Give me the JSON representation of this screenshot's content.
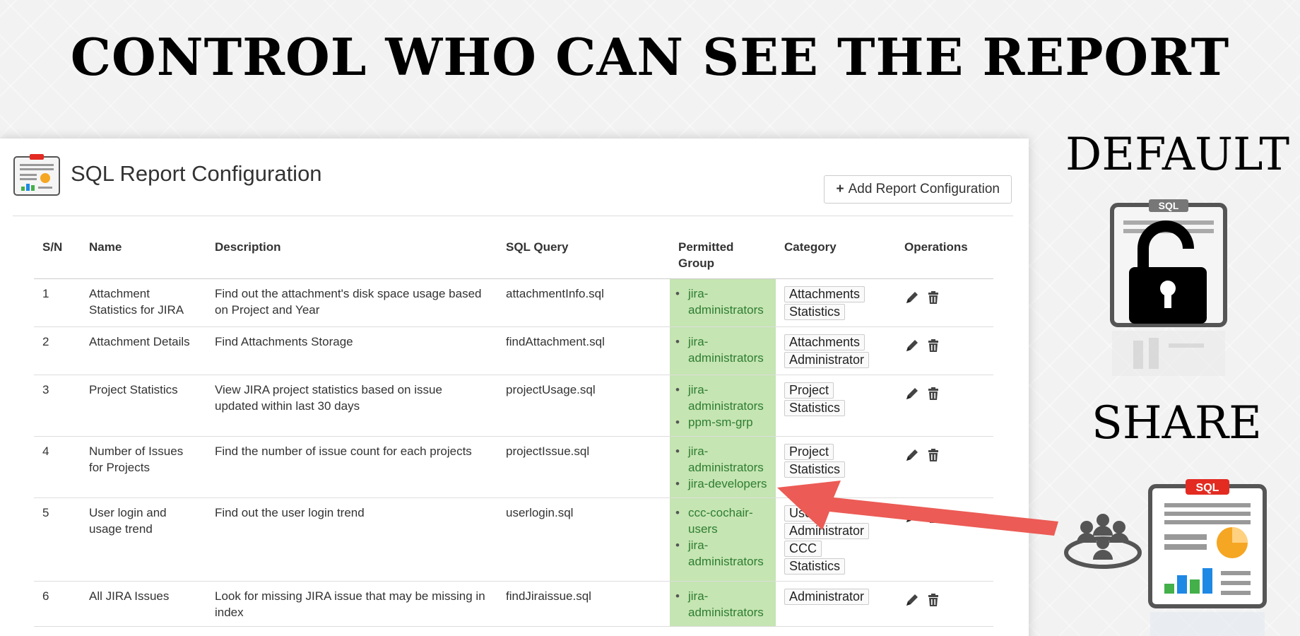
{
  "headline": "CONTROL WHO CAN SEE THE REPORT",
  "side": {
    "default_label": "DEFAULT",
    "share_label": "SHARE",
    "sql_badge": "SQL"
  },
  "panel": {
    "title": "SQL Report Configuration",
    "add_button": "Add Report Configuration",
    "columns": [
      "S/N",
      "Name",
      "Description",
      "SQL Query",
      "Permitted Group",
      "Category",
      "Operations"
    ],
    "rows": [
      {
        "sn": "1",
        "name": "Attachment Statistics for JIRA",
        "description": "Find out the attachment's disk space usage based on Project and Year",
        "query": "attachmentInfo.sql",
        "groups": [
          "jira-administrators"
        ],
        "categories": [
          "Attachments",
          "Statistics"
        ]
      },
      {
        "sn": "2",
        "name": "Attachment Details",
        "description": "Find Attachments Storage",
        "query": "findAttachment.sql",
        "groups": [
          "jira-administrators"
        ],
        "categories": [
          "Attachments",
          "Administrator"
        ]
      },
      {
        "sn": "3",
        "name": "Project Statistics",
        "description": "View JIRA project statistics based on issue updated within last 30 days",
        "query": "projectUsage.sql",
        "groups": [
          "jira-administrators",
          "ppm-sm-grp"
        ],
        "categories": [
          "Project",
          "Statistics"
        ]
      },
      {
        "sn": "4",
        "name": "Number of Issues for Projects",
        "description": "Find the number of issue count for each projects",
        "query": "projectIssue.sql",
        "groups": [
          "jira-administrators",
          "jira-developers"
        ],
        "categories": [
          "Project",
          "Statistics"
        ]
      },
      {
        "sn": "5",
        "name": "User login and usage trend",
        "description": "Find out the user login trend",
        "query": "userlogin.sql",
        "groups": [
          "ccc-cochair-users",
          "jira-administrators"
        ],
        "categories": [
          "User",
          "Administrator",
          "CCC",
          "Statistics"
        ]
      },
      {
        "sn": "6",
        "name": "All JIRA Issues",
        "description": "Look for missing JIRA issue that may be missing in index",
        "query": "findJiraissue.sql",
        "groups": [
          "jira-administrators"
        ],
        "categories": [
          "Administrator"
        ]
      }
    ]
  },
  "colors": {
    "permitted_group_bg": "#c5e5b2",
    "arrow": "#ec5b55",
    "sql_badge": "#e32b22"
  }
}
